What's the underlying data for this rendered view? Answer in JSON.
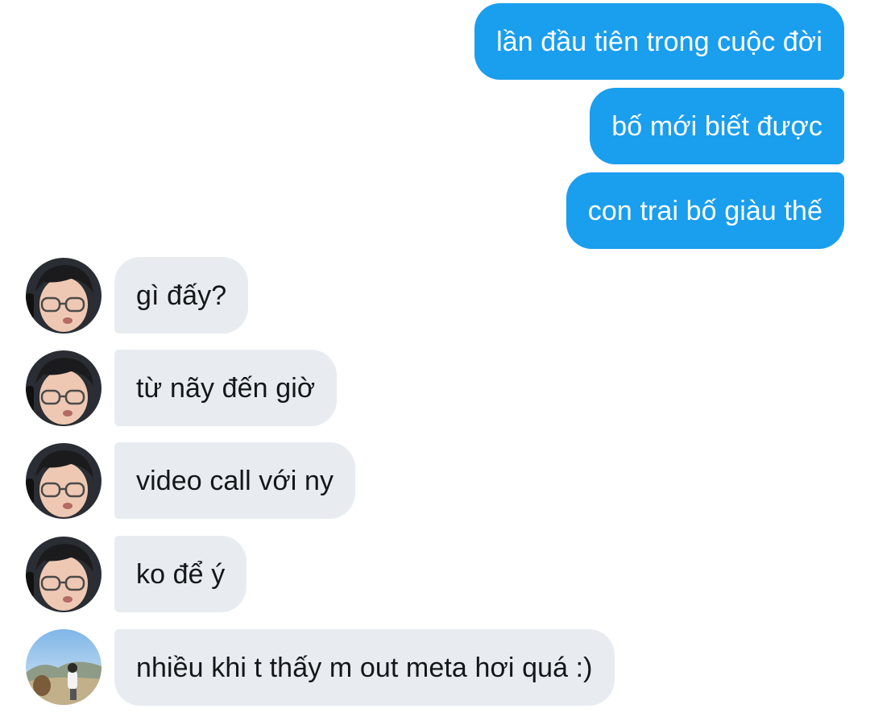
{
  "conversation": {
    "outgoing": [
      "lần đầu tiên trong cuộc đời",
      "bố mới biết được",
      "con trai bố giàu thế"
    ],
    "incoming": [
      "gì đấy?",
      "từ nãy đến giờ",
      "video call với ny",
      "ko để ý",
      "nhiều khi t thấy m out meta hơi quá :)"
    ]
  },
  "colors": {
    "outgoing_bubble": "#1a9eee",
    "incoming_bubble": "#e8ecf0"
  },
  "avatars": [
    "user-avatar-face",
    "user-avatar-face",
    "user-avatar-face",
    "user-avatar-face",
    "user-avatar-landscape"
  ]
}
